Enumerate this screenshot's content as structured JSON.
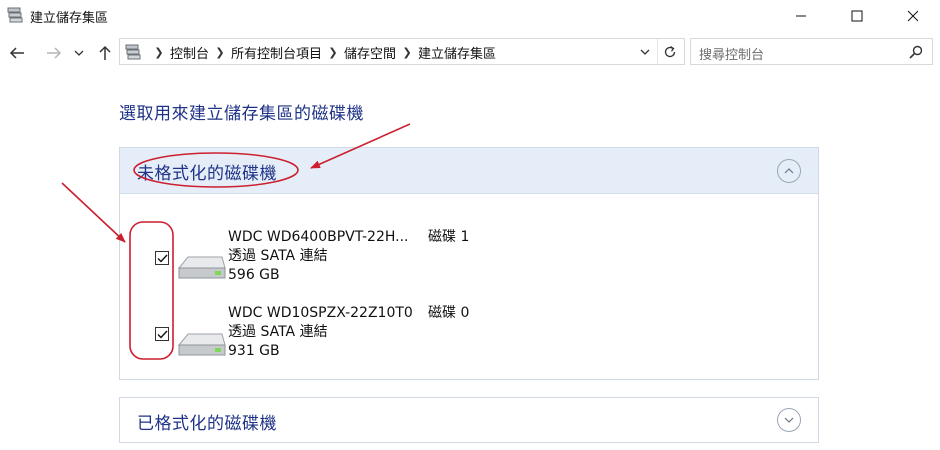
{
  "window": {
    "title": "建立儲存集區"
  },
  "address_bar": {
    "crumbs": [
      "控制台",
      "所有控制台項目",
      "儲存空間",
      "建立儲存集區"
    ]
  },
  "search": {
    "placeholder": "搜尋控制台"
  },
  "heading": "選取用來建立儲存集區的磁碟機",
  "groups": [
    {
      "title": "未格式化的磁碟機",
      "expanded": true,
      "drives": [
        {
          "name": "WDC WD6400BPVT-22H...",
          "disk": "磁碟 1",
          "connection": "透過 SATA 連結",
          "size": "596 GB",
          "checked": true
        },
        {
          "name": "WDC WD10SPZX-22Z10T0",
          "disk": "磁碟 0",
          "connection": "透過 SATA 連結",
          "size": "931 GB",
          "checked": true
        }
      ]
    },
    {
      "title": "已格式化的磁碟機",
      "expanded": false,
      "drives": []
    }
  ],
  "colors": {
    "heading": "#1e3287",
    "panel_header_bg": "#e5eef8",
    "annotation": "#cc1f2f"
  },
  "icons": [
    "storage-spaces-icon",
    "minimize-icon",
    "maximize-icon",
    "close-icon",
    "back-arrow-icon",
    "forward-arrow-icon",
    "recent-dropdown-icon",
    "up-arrow-icon",
    "breadcrumb-chevron-icon",
    "refresh-icon",
    "search-icon",
    "collapse-chevron-icon",
    "expand-chevron-icon",
    "hard-drive-icon",
    "checkmark-icon"
  ]
}
